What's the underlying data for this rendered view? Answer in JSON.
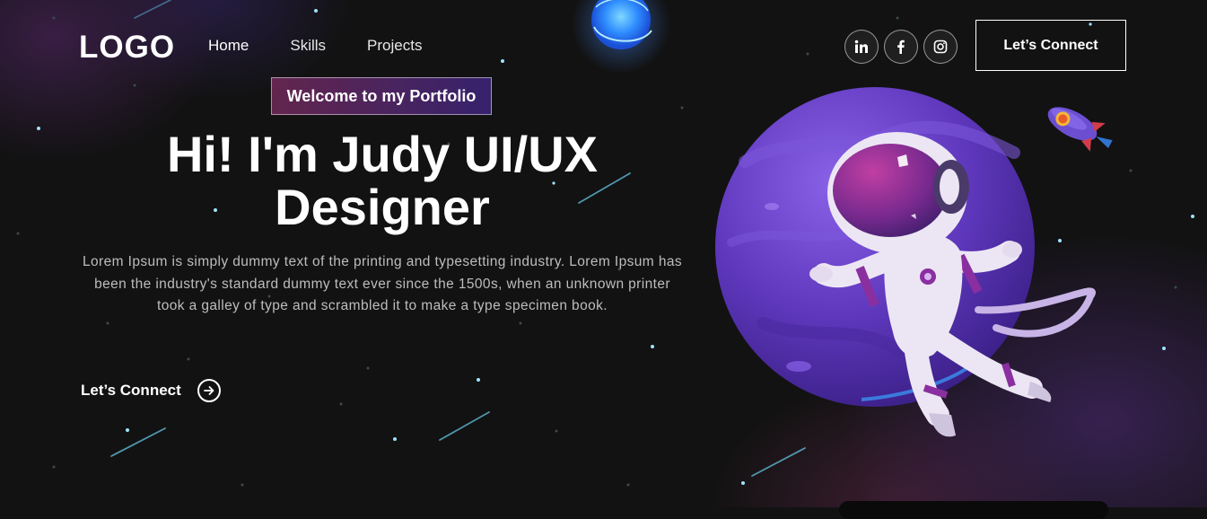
{
  "logo": "LOGO",
  "nav": {
    "items": [
      "Home",
      "Skills",
      "Projects"
    ],
    "active": "Home"
  },
  "social": [
    "linkedin-icon",
    "facebook-icon",
    "instagram-icon"
  ],
  "header_button": "Let’s Connect",
  "hero": {
    "tagline": "Welcome to my Portfolio",
    "headline_line1": "Hi! I'm Judy UI/UX",
    "headline_line2": "Designer",
    "description": "Lorem Ipsum is simply dummy text of the printing and typesetting industry. Lorem Ipsum has been the industry's standard dummy text ever since the 1500s, when an unknown printer took a galley of type and scrambled it to make a type specimen book.",
    "cta": "Let’s Connect"
  },
  "colors": {
    "background": "#121212",
    "planet": "#6a3fc2",
    "accent_pink": "#aa367c",
    "accent_blue": "#4a2fbd"
  }
}
